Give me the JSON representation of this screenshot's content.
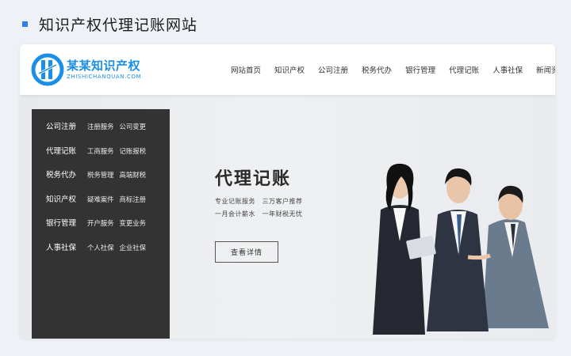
{
  "page_title": "知识产权代理记账网站",
  "logo": {
    "name": "某某知识产权",
    "subtitle": "ZHISHICHANQUAN.COM"
  },
  "nav": {
    "items": [
      "网站首页",
      "知识产权",
      "公司注册",
      "税务代办",
      "银行管理",
      "代理记账",
      "人事社保",
      "新闻资讯"
    ]
  },
  "menu": [
    {
      "main": "公司注册",
      "subs": [
        "注册服务",
        "公司变更"
      ]
    },
    {
      "main": "代理记账",
      "subs": [
        "工商服务",
        "记账报税"
      ]
    },
    {
      "main": "税务代办",
      "subs": [
        "税务管理",
        "高端财税"
      ]
    },
    {
      "main": "知识产权",
      "subs": [
        "疑难案件",
        "商标注册"
      ]
    },
    {
      "main": "银行管理",
      "subs": [
        "开户服务",
        "变更业务"
      ]
    },
    {
      "main": "人事社保",
      "subs": [
        "个人社保",
        "企业社保"
      ]
    }
  ],
  "banner": {
    "title": "代理记账",
    "line1": "专业记账服务　三万客户推荐",
    "line2": "一月会计薪水　一年财税无忧",
    "button": "查看详情"
  },
  "colors": {
    "accent": "#2f7df0",
    "brand": "#1b8fe8",
    "menu_bg": "#333334"
  }
}
